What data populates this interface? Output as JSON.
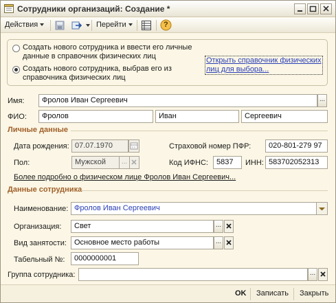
{
  "window": {
    "title": "Сотрудники организаций: Создание *"
  },
  "toolbar": {
    "actions_label": "Действия",
    "goto_label": "Перейти",
    "help_label": "?"
  },
  "mode": {
    "option_new_person": "Создать нового сотрудника и ввести его личные данные в справочник физических лиц",
    "option_new_person_line1": "Создать нового сотрудника и ввести его личные",
    "option_new_person_line2": "данные в справочник физических лиц",
    "option_select_person_line1": "Создать нового сотрудника, выбрав его из",
    "option_select_person_line2": "справочника физических лиц",
    "selected": "select_person",
    "open_link_line1": "Открыть справочник физических",
    "open_link_line2": "лиц для выбора..."
  },
  "name": {
    "label": "Имя:",
    "value": "Фролов Иван  Сергеевич"
  },
  "fio": {
    "label": "ФИО:",
    "last_name": "Фролов",
    "first_name": "Иван",
    "middle_name": "Сергеевич"
  },
  "personal": {
    "section_title": "Личные данные",
    "birth_date_label": "Дата рождения:",
    "birth_date_value": "07.07.1970",
    "snils_label": "Страховой номер ПФР:",
    "snils_value": "020-801-279 97",
    "gender_label": "Пол:",
    "gender_value": "Мужской",
    "ifns_label": "Код ИФНС:",
    "ifns_value": "5837",
    "inn_label": "ИНН:",
    "inn_value": "583702052313",
    "more_link": "Более подробно о физическом лице Фролов Иван  Сергеевич..."
  },
  "employee": {
    "section_title": "Данные сотрудника",
    "name_label": "Наименование:",
    "name_value": "Фролов Иван  Сергеевич",
    "org_label": "Организация:",
    "org_value": "Свет",
    "employment_label": "Вид занятости:",
    "employment_value": "Основное место работы",
    "tab_number_label": "Табельный №:",
    "tab_number_value": "0000000001",
    "group_label": "Группа сотрудника:",
    "group_value": ""
  },
  "footer": {
    "ok_label": "OK",
    "save_label": "Записать",
    "close_label": "Закрыть"
  },
  "colors": {
    "section_title": "#a0602a",
    "link": "#2a3fb5",
    "window_bg": "#fbf6e5"
  }
}
